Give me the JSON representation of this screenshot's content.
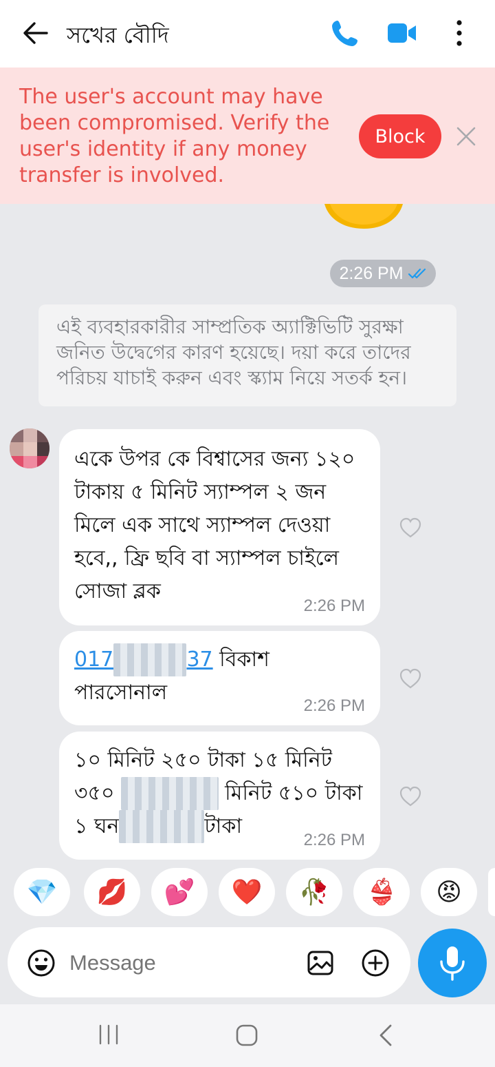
{
  "header": {
    "contact_name": "সখের বৌদি"
  },
  "banner": {
    "warning_text": "The user's account may have been compromised. Verify the user's identity if any money transfer is involved.",
    "block_label": "Block"
  },
  "messages": {
    "sent_time": "2:26 PM",
    "system_notice": "এই ব্যবহারকারীর সাম্প্রতিক অ্যাক্টিভিটি সুরক্ষা জনিত উদ্বেগের কারণ হয়েছে। দয়া করে তাদের পরিচয় যাচাই করুন এবং স্ক্যাম নিয়ে সতর্ক হন।",
    "incoming": [
      {
        "text": "একে উপর কে বিশ্বাসের জন্য ১২০ টাকায় ৫ মিনিট স্যাম্পল ২ জন  মিলে এক সাথে স্যাম্পল দেওয়া হবে,, ফ্রি  ছবি বা স্যাম্পল চাইলে সোজা ব্লক",
        "time": "2:26 PM"
      },
      {
        "link_start": "017",
        "link_end": "37",
        "text": " বিকাশ পারসোনাল",
        "time": "2:26 PM"
      },
      {
        "line1": "১০ মিনিট ২৫০ টাকা ১৫ মিনিট",
        "line2_a": "৩৫০ ",
        "line2_b": " মিনিট ৫১০ টাকা",
        "line3_a": "১ ঘন",
        "line3_b": "টাকা",
        "time": "2:26 PM"
      }
    ]
  },
  "reactions": [
    "💎",
    "💋",
    "💕",
    "❤️",
    "🥀",
    "👙",
    "😡"
  ],
  "composer": {
    "placeholder": "Message"
  },
  "colors": {
    "accent": "#1b9bf0",
    "warning_bg": "#fde1e1",
    "warning_text": "#e8534f",
    "block_button": "#f43d3d"
  }
}
